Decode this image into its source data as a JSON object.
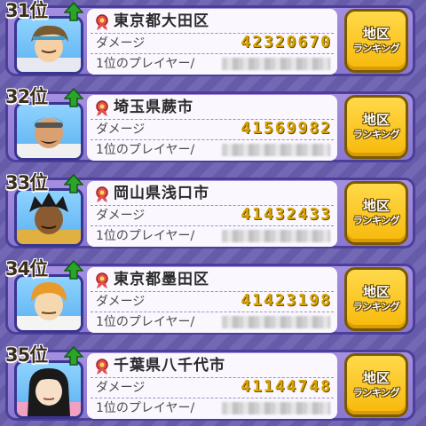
{
  "icons": {
    "rank_up": "green-up-arrow-icon",
    "region": "red-ribbon-badge-icon"
  },
  "colors": {
    "card": "#8a78d0",
    "button": "#f7b90a",
    "damage": "#d9a400",
    "arrow": "#2aa52a"
  },
  "damage_label": "ダメージ",
  "player_label": "1位のプレイヤー/",
  "button": {
    "line1": "地区",
    "line2": "ランキング"
  },
  "rows": [
    {
      "rank": "31位",
      "region": "東京都大田区",
      "damage": "42320670"
    },
    {
      "rank": "32位",
      "region": "埼玉県蕨市",
      "damage": "41569982"
    },
    {
      "rank": "33位",
      "region": "岡山県浅口市",
      "damage": "41432433"
    },
    {
      "rank": "34位",
      "region": "東京都墨田区",
      "damage": "41423198"
    },
    {
      "rank": "35位",
      "region": "千葉県八千代市",
      "damage": "41144748"
    }
  ]
}
